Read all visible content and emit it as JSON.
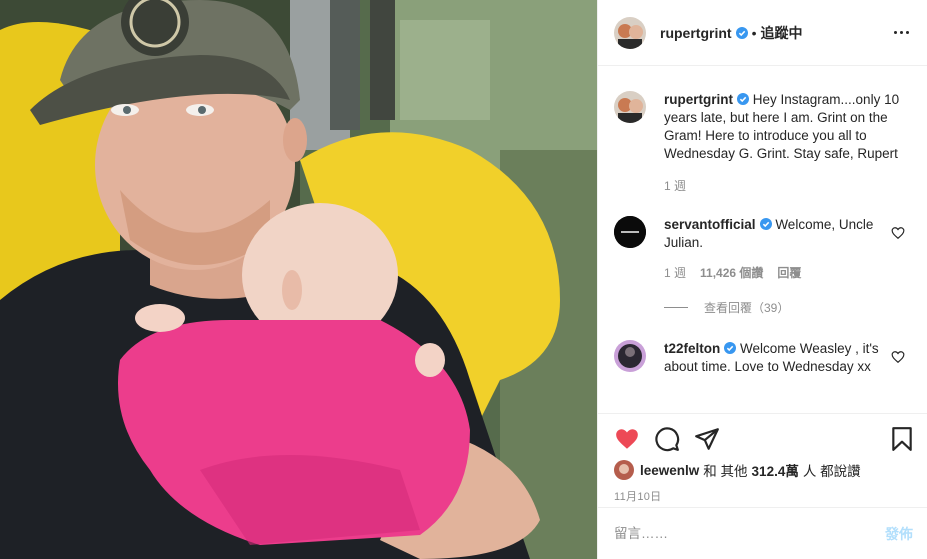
{
  "header": {
    "username": "rupertgrint",
    "separator": "•",
    "follow_label": "追蹤中"
  },
  "caption": {
    "username": "rupertgrint",
    "text": "Hey Instagram....only 10 years late, but here I am. Grint on the Gram! Here to introduce you all to Wednesday G. Grint. Stay safe, Rupert",
    "time": "1 週"
  },
  "comments": [
    {
      "username": "servantofficial",
      "text": "Welcome, Uncle Julian.",
      "time": "1 週",
      "likes": "11,426 個讚",
      "reply_label": "回覆",
      "view_replies": "查看回覆（39）"
    },
    {
      "username": "t22felton",
      "text": "Welcome Weasley , it's about time. Love to Wednesday xx"
    }
  ],
  "actions": {
    "liked_by_user": "leewenlw",
    "liked_by_text_1": "和 其他",
    "liked_count": "312.4萬",
    "liked_by_text_2": "人 都說讚",
    "date": "11月10日"
  },
  "add_comment": {
    "placeholder": "留言……",
    "post_label": "發佈"
  },
  "icons": {
    "like": "heart-filled-icon",
    "comment": "comment-bubble-icon",
    "share": "paper-plane-icon",
    "save": "bookmark-icon",
    "more": "more-options-icon",
    "verified": "verified-badge-icon"
  },
  "colors": {
    "like_red": "#ed4956",
    "verified_blue": "#3897f0",
    "post_button_disabled": "#b2dffc"
  }
}
